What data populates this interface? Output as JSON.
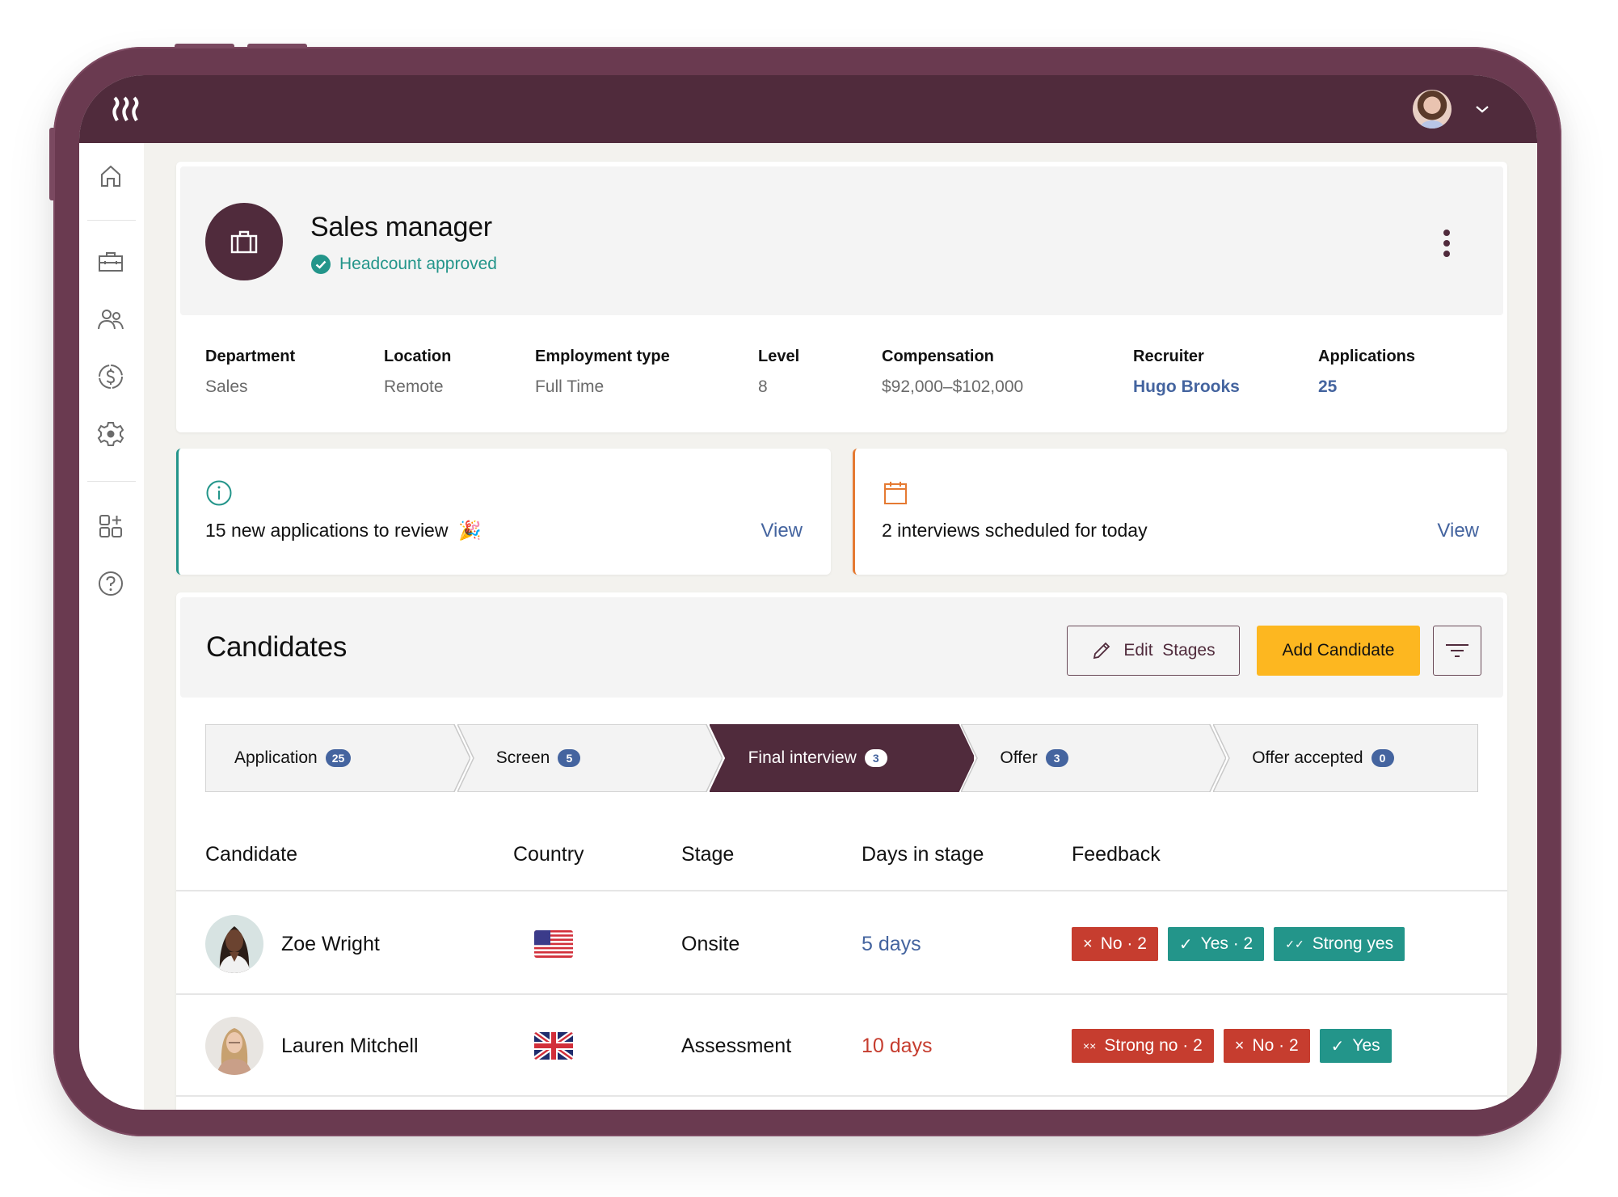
{
  "app": {
    "logo": "brand-logo",
    "user_menu": {
      "avatar": "user-avatar",
      "chevron": "chevron-down-icon"
    }
  },
  "sidebar": {
    "items": [
      {
        "name": "home",
        "icon": "home-icon"
      },
      {
        "name": "jobs",
        "icon": "briefcase-icon"
      },
      {
        "name": "people",
        "icon": "people-icon"
      },
      {
        "name": "payroll",
        "icon": "dollar-icon"
      },
      {
        "name": "settings",
        "icon": "gear-icon"
      },
      {
        "name": "apps",
        "icon": "add-apps-icon"
      },
      {
        "name": "help",
        "icon": "help-icon"
      }
    ]
  },
  "job": {
    "title": "Sales manager",
    "status": "Headcount approved",
    "meta": [
      {
        "label": "Department",
        "value": "Sales"
      },
      {
        "label": "Location",
        "value": "Remote"
      },
      {
        "label": "Employment type",
        "value": "Full Time"
      },
      {
        "label": "Level",
        "value": "8"
      },
      {
        "label": "Compensation",
        "value": "$92,000–$102,000"
      },
      {
        "label": "Recruiter",
        "value": "Hugo Brooks"
      },
      {
        "label": "Applications",
        "value": "25"
      }
    ]
  },
  "notices": [
    {
      "text": "15 new applications to review",
      "emoji": "🎉",
      "action": "View",
      "icon": "info-icon"
    },
    {
      "text": "2 interviews scheduled for today",
      "action": "View",
      "icon": "calendar-icon"
    }
  ],
  "candidates": {
    "title": "Candidates",
    "edit_stages_label": "Edit  Stages",
    "add_candidate_label": "Add Candidate",
    "stages": [
      {
        "label": "Application",
        "count": "25",
        "active": false
      },
      {
        "label": "Screen",
        "count": "5",
        "active": false
      },
      {
        "label": "Final interview",
        "count": "3",
        "active": true
      },
      {
        "label": "Offer",
        "count": "3",
        "active": false
      },
      {
        "label": "Offer accepted",
        "count": "0",
        "active": false
      }
    ],
    "columns": [
      "Candidate",
      "Country",
      "Stage",
      "Days in stage",
      "Feedback"
    ],
    "rows": [
      {
        "name": "Zoe Wright",
        "country": "United States",
        "stage": "Onsite",
        "days": "5 days",
        "days_status": "ok",
        "feedback": [
          {
            "icon": "×",
            "label": "No · 2",
            "kind": "neg"
          },
          {
            "icon": "✓",
            "label": "Yes · 2",
            "kind": "pos"
          },
          {
            "icon": "✓✓",
            "label": "Strong yes",
            "kind": "pos"
          }
        ]
      },
      {
        "name": "Lauren Mitchell",
        "country": "United Kingdom",
        "stage": "Assessment",
        "days": "10 days",
        "days_status": "late",
        "feedback": [
          {
            "icon": "××",
            "label": "Strong no · 2",
            "kind": "neg"
          },
          {
            "icon": "×",
            "label": "No · 2",
            "kind": "neg"
          },
          {
            "icon": "✓",
            "label": "Yes",
            "kind": "pos"
          }
        ]
      }
    ]
  },
  "colors": {
    "brand": "#502b3c",
    "accent_yellow": "#fdb720",
    "teal": "#23958a",
    "link_blue": "#44649f",
    "danger": "#c63d2f",
    "orange": "#e57a32"
  }
}
